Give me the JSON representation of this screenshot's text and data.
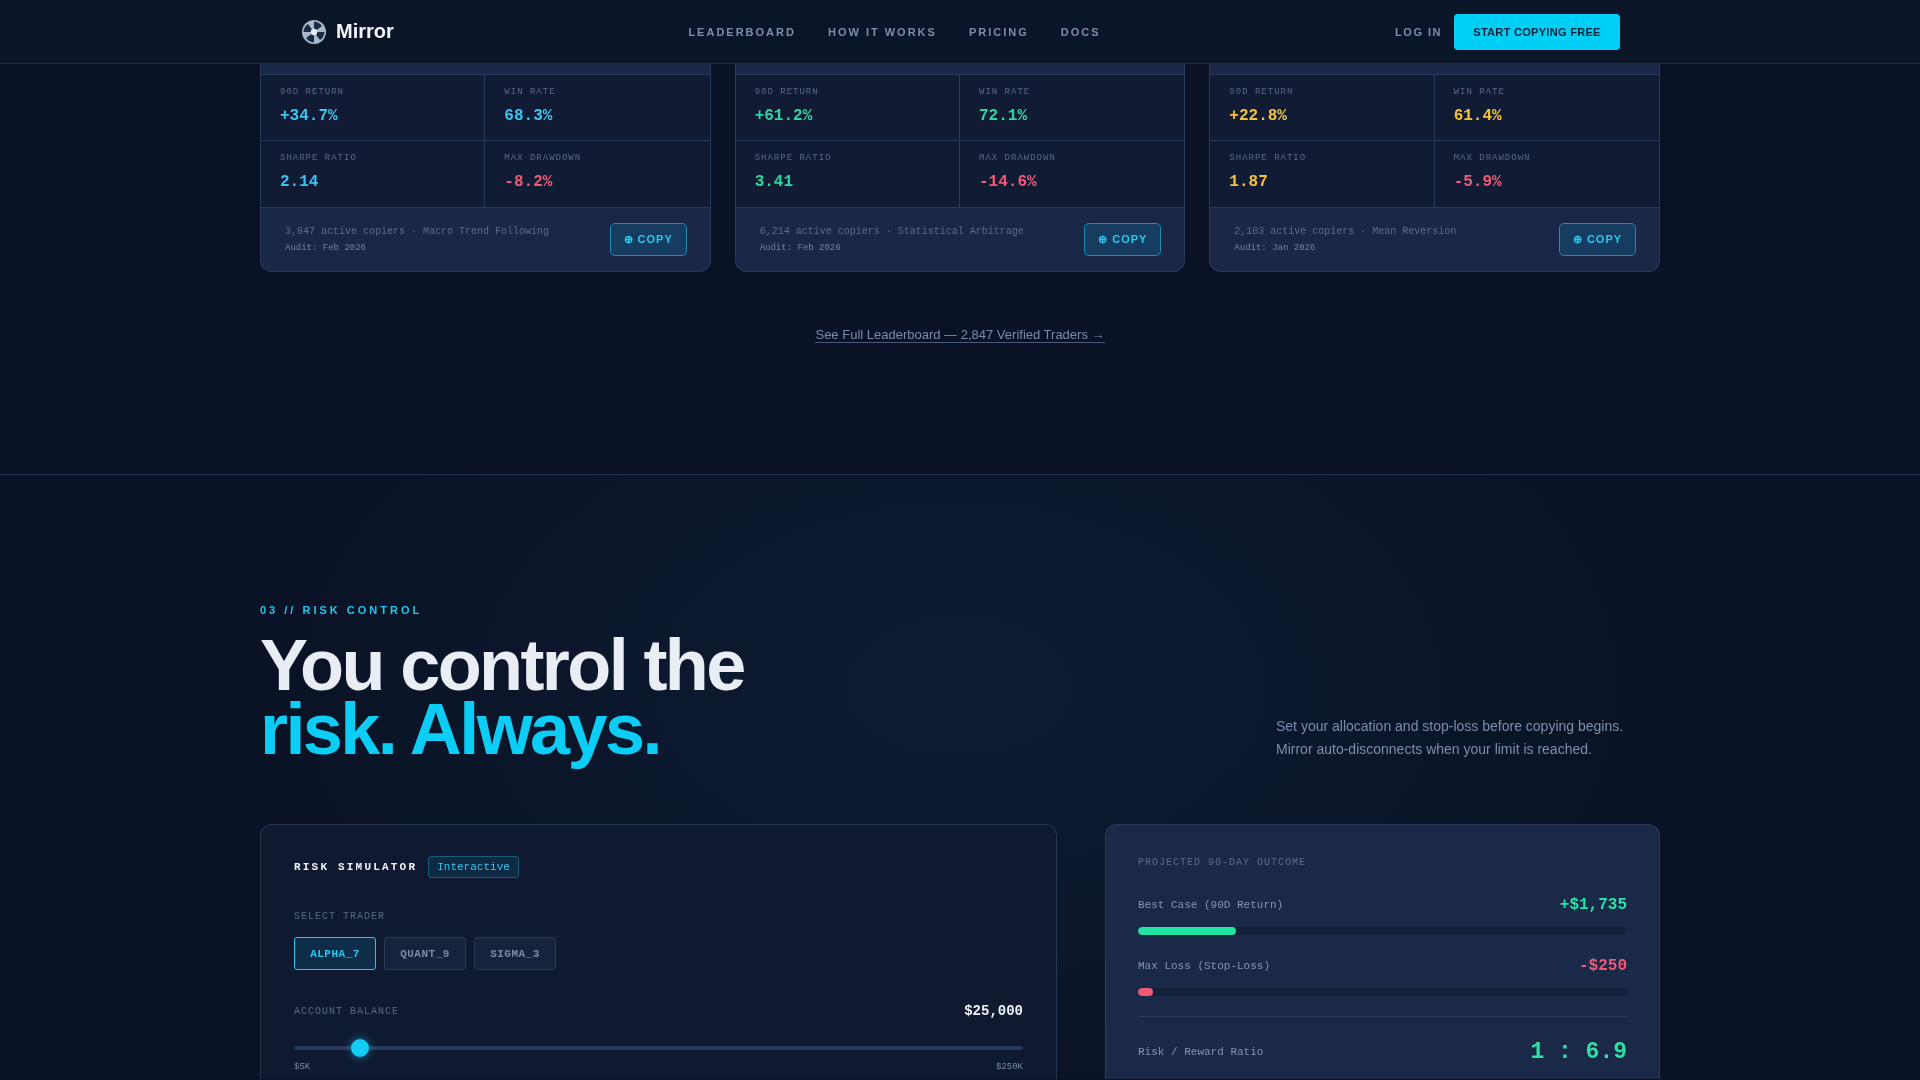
{
  "nav": {
    "brand": "Mirror",
    "links": [
      "LEADERBOARD",
      "HOW IT WORKS",
      "PRICING",
      "DOCS"
    ],
    "login": "LOG IN",
    "cta": "START COPYING FREE"
  },
  "trader_cards": [
    {
      "color": "#3cc3f2",
      "metrics": [
        {
          "label": "90D RETURN",
          "value": "+34.7%",
          "kind": "accent"
        },
        {
          "label": "WIN RATE",
          "value": "68.3%",
          "kind": "accent"
        },
        {
          "label": "SHARPE RATIO",
          "value": "2.14",
          "kind": "accent"
        },
        {
          "label": "MAX DRAWDOWN",
          "value": "-8.2%",
          "kind": "loss"
        }
      ],
      "copiers": "3,847 active copiers · Macro Trend Following",
      "audit": "Audit: Feb 2026",
      "copy_button": "⊕ COPY"
    },
    {
      "color": "#2fd6a0",
      "metrics": [
        {
          "label": "90D RETURN",
          "value": "+61.2%",
          "kind": "accent"
        },
        {
          "label": "WIN RATE",
          "value": "72.1%",
          "kind": "accent"
        },
        {
          "label": "SHARPE RATIO",
          "value": "3.41",
          "kind": "accent"
        },
        {
          "label": "MAX DRAWDOWN",
          "value": "-14.6%",
          "kind": "loss"
        }
      ],
      "copiers": "6,214 active copiers · Statistical Arbitrage",
      "audit": "Audit: Feb 2026",
      "copy_button": "⊕ COPY"
    },
    {
      "color": "#f5c23a",
      "metrics": [
        {
          "label": "90D RETURN",
          "value": "+22.8%",
          "kind": "accent"
        },
        {
          "label": "WIN RATE",
          "value": "61.4%",
          "kind": "accent"
        },
        {
          "label": "SHARPE RATIO",
          "value": "1.87",
          "kind": "accent"
        },
        {
          "label": "MAX DRAWDOWN",
          "value": "-5.9%",
          "kind": "loss"
        }
      ],
      "copiers": "2,103 active copiers · Mean Reversion",
      "audit": "Audit: Jan 2026",
      "copy_button": "⊕ COPY"
    }
  ],
  "leaderboard_link": "See Full Leaderboard — 2,847 Verified Traders →",
  "risk_section": {
    "eyebrow": "03 // RISK CONTROL",
    "heading": "You control the",
    "heading_highlight": "risk. Always.",
    "description": "Set your allocation and stop-loss before copying begins. Mirror auto-disconnects when your limit is reached."
  },
  "simulator": {
    "title": "RISK SIMULATOR",
    "badge": "Interactive",
    "trader_label": "SELECT TRADER",
    "traders": [
      {
        "label": "ALPHA_7",
        "selected": true
      },
      {
        "label": "QUANT_9",
        "selected": false
      },
      {
        "label": "SIGMA_3",
        "selected": false
      }
    ],
    "balance_label": "ACCOUNT BALANCE",
    "balance": "$25,000",
    "slider": {
      "level": 0.08,
      "min_label": "$5K",
      "max_label": "$250K"
    }
  },
  "outcome": {
    "title": "PROJECTED 90-DAY OUTCOME",
    "rows": [
      {
        "label": "Best Case (90D Return)",
        "value": "+$1,735",
        "kind": "gain",
        "level": 0.2
      },
      {
        "label": "Max Loss (Stop-Loss)",
        "value": "-$250",
        "kind": "loss",
        "level": 0.03
      }
    ],
    "ratio_label": "Risk / Reward Ratio",
    "ratio": "1 : 6.9"
  }
}
